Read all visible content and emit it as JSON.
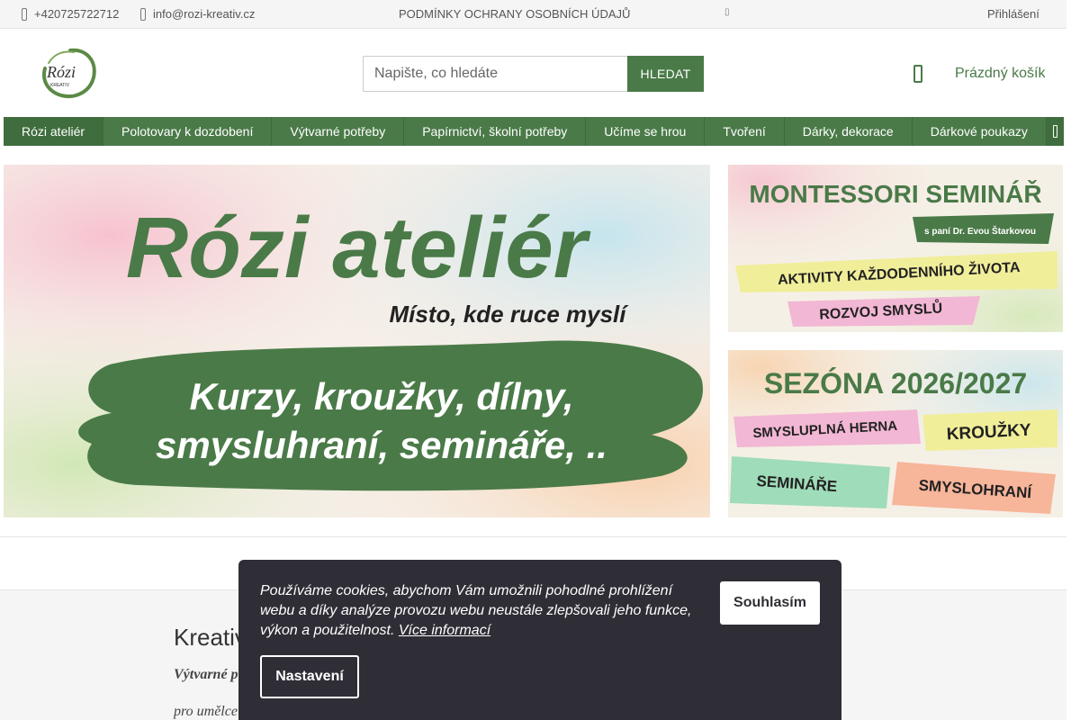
{
  "topbar": {
    "phone": "+420725722712",
    "email": "info@rozi-kreativ.cz",
    "privacy_link": "PODMÍNKY OCHRANY OSOBNÍCH ÚDAJŮ",
    "login": "Přihlášení"
  },
  "header": {
    "logo_text": "Rózi",
    "logo_sub": "KREATIV",
    "search_placeholder": "Napište, co hledáte",
    "search_button": "HLEDAT",
    "cart_label": "Prázdný košík"
  },
  "nav": {
    "items": [
      {
        "label": "Rózi ateliér"
      },
      {
        "label": "Polotovary k dozdobení"
      },
      {
        "label": "Výtvarné potřeby"
      },
      {
        "label": "Papírnictví, školní potřeby"
      },
      {
        "label": "Učíme se hrou"
      },
      {
        "label": "Tvoření"
      },
      {
        "label": "Dárky, dekorace"
      },
      {
        "label": "Dárkové poukazy"
      }
    ]
  },
  "banners": {
    "main": {
      "title": "Rózi ateliér",
      "tagline": "Místo, kde ruce myslí",
      "line1": "Kurzy, kroužky, dílny,",
      "line2": "smysluhraní, semináře, .."
    },
    "montessori": {
      "title": "MONTESSORI SEMINÁŘ",
      "subtitle": "s paní Dr. Evou Štarkovou",
      "tag1": "AKTIVITY KAŽDODENNÍHO ŽIVOTA",
      "tag2": "ROZVOJ SMYSLŮ"
    },
    "season": {
      "title": "SEZÓNA 2026/2027",
      "tag1": "SMYSLUPLNÁ HERNA",
      "tag2": "KROUŽKY",
      "tag3": "SEMINÁŘE",
      "tag4": "SMYSLOHRANÍ"
    }
  },
  "content": {
    "title": "Kreativ",
    "paragraph1": "Výtvarné p",
    "paragraph2": "pro umělce"
  },
  "cookie": {
    "text": "Používáme cookies, abychom Vám umožnili pohodlné prohlížení webu a díky analýze provozu webu neustále zlepšovali jeho funkce, výkon a použitelnost.",
    "link": "Více informací",
    "accept": "Souhlasím",
    "settings": "Nastavení"
  },
  "colors": {
    "brand_green": "#4a7a48",
    "cookie_bg": "#2f2e36"
  }
}
